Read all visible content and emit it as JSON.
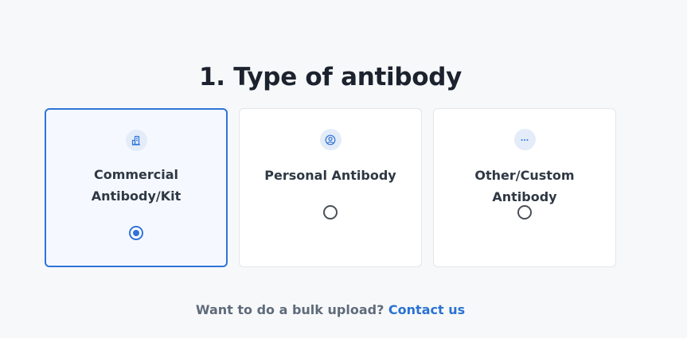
{
  "page": {
    "title": "1. Type of antibody"
  },
  "options": [
    {
      "label": "Commercial Antibody/Kit",
      "icon": "building-icon",
      "selected": true
    },
    {
      "label": "Personal Antibody",
      "icon": "user-circle-icon",
      "selected": false
    },
    {
      "label": "Other/Custom Antibody",
      "icon": "more-dots-icon",
      "selected": false
    }
  ],
  "footer": {
    "text": "Want to do a bulk upload?",
    "link_label": "Contact us"
  },
  "colors": {
    "accent": "#2f74d9",
    "background": "#f7f8fa",
    "icon_bg": "#e3ecf8"
  }
}
